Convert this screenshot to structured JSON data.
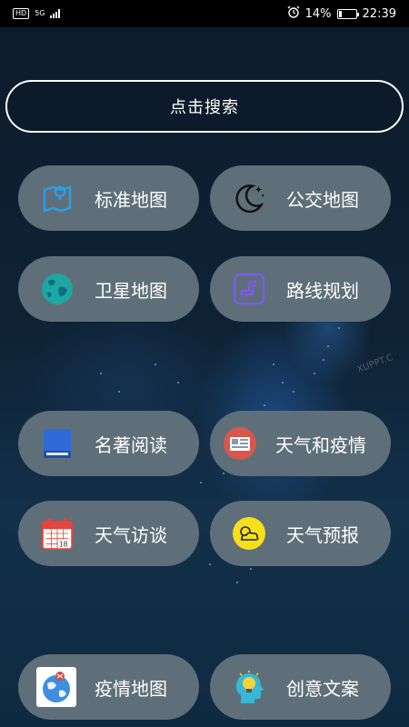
{
  "status_bar": {
    "hd": "HD",
    "network": "5G",
    "battery_percent": "14%",
    "battery_level": 0.14,
    "time": "22:39",
    "icons": [
      "alarm-icon",
      "battery-charging-icon",
      "signal-icon"
    ]
  },
  "search": {
    "label": "点击搜索"
  },
  "tiles": [
    {
      "label": "标准地图",
      "icon": "map-pin-icon"
    },
    {
      "label": "公交地图",
      "icon": "moon-stars-icon"
    },
    {
      "label": "卫星地图",
      "icon": "globe-icon"
    },
    {
      "label": "路线规划",
      "icon": "route-icon"
    },
    {
      "label": "名著阅读",
      "icon": "book-icon"
    },
    {
      "label": "天气和疫情",
      "icon": "newspaper-icon"
    },
    {
      "label": "天气访谈",
      "icon": "calendar-icon"
    },
    {
      "label": "天气预报",
      "icon": "sun-cloud-icon"
    },
    {
      "label": "疫情地图",
      "icon": "earth-map-icon"
    },
    {
      "label": "创意文案",
      "icon": "lightbulb-head-icon"
    }
  ],
  "watermark": "XUPPT.C",
  "colors": {
    "tile_bg": "#5e6f79",
    "page_bg": "#0b1a2a",
    "text": "#ffffff"
  }
}
